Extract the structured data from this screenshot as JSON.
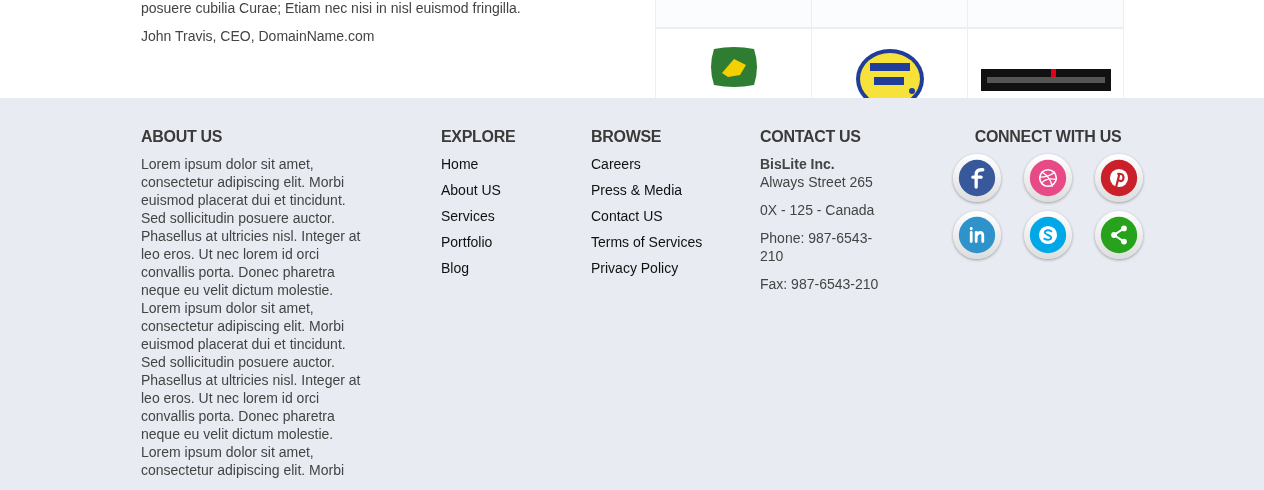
{
  "testimonial": {
    "text": "posuere cubilia Curae; Etiam nec nisi in nisl euismod fringilla.",
    "author": "John Travis, CEO, DomainName.com"
  },
  "footer": {
    "about": {
      "title": "ABOUT US",
      "text": "Lorem ipsum dolor sit amet, consectetur adipiscing elit. Morbi euismod placerat dui et tincidunt. Sed sollicitudin posuere auctor. Phasellus at ultricies nisl. Integer at leo eros. Ut nec lorem id orci convallis porta. Donec pharetra neque eu velit dictum molestie. Lorem ipsum dolor sit amet, consectetur adipiscing elit. Morbi euismod placerat dui et tincidunt. Sed sollicitudin posuere auctor. Phasellus at ultricies nisl. Integer at leo eros. Ut nec lorem id orci convallis porta. Donec pharetra neque eu velit dictum molestie. Lorem ipsum dolor sit amet, consectetur adipiscing elit. Morbi"
    },
    "explore": {
      "title": "EXPLORE",
      "links": [
        "Home",
        "About US",
        "Services",
        "Portfolio",
        "Blog"
      ]
    },
    "browse": {
      "title": "BROWSE",
      "links": [
        "Careers",
        "Press & Media",
        "Contact US",
        "Terms of Services",
        "Privacy Policy"
      ]
    },
    "contact": {
      "title": "CONTACT US",
      "company": "BisLite Inc.",
      "lines": [
        "Always Street 265",
        "0X - 125 - Canada",
        "Phone: 987-6543-210",
        "Fax: 987-6543-210"
      ]
    },
    "connect": {
      "title": "CONNECT WITH US",
      "networks": [
        {
          "kind": "facebook",
          "color": "#37589a"
        },
        {
          "kind": "dribbble",
          "color": "#e84a87"
        },
        {
          "kind": "pinterest",
          "color": "#c9202a"
        },
        {
          "kind": "linkedin",
          "color": "#2f93cb"
        },
        {
          "kind": "skype",
          "color": "#00a8e8"
        },
        {
          "kind": "share",
          "color": "#26a21c"
        }
      ]
    }
  }
}
